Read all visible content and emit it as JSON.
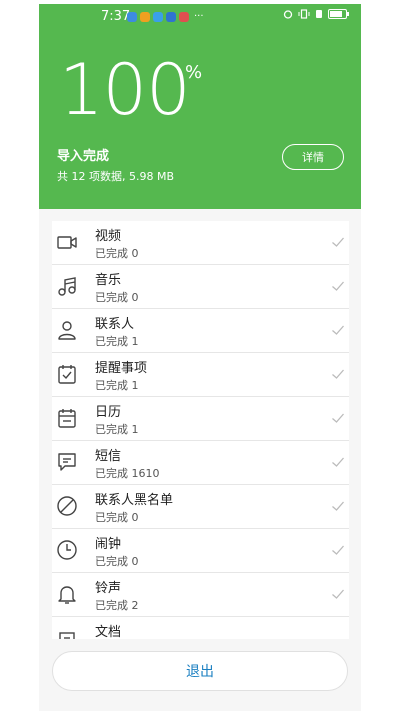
{
  "status_bar": {
    "time": "7:37",
    "more": "···"
  },
  "header": {
    "percent": "100",
    "percent_sign": "%",
    "title": "导入完成",
    "summary": "共 12 项数据, 5.98 MB",
    "details_label": "详情"
  },
  "colors": {
    "header_bg": "#55b84f",
    "exit_text": "#1a7fc1"
  },
  "items": [
    {
      "label": "视频",
      "status": "已完成  0",
      "icon": "video-icon"
    },
    {
      "label": "音乐",
      "status": "已完成  0",
      "icon": "music-icon"
    },
    {
      "label": "联系人",
      "status": "已完成  1",
      "icon": "contact-icon"
    },
    {
      "label": "提醒事项",
      "status": "已完成  1",
      "icon": "reminder-icon"
    },
    {
      "label": "日历",
      "status": "已完成  1",
      "icon": "calendar-icon"
    },
    {
      "label": "短信",
      "status": "已完成  1610",
      "icon": "message-icon"
    },
    {
      "label": "联系人黑名单",
      "status": "已完成  0",
      "icon": "blocked-icon"
    },
    {
      "label": "闹钟",
      "status": "已完成  0",
      "icon": "clock-icon"
    },
    {
      "label": "铃声",
      "status": "已完成  2",
      "icon": "bell-icon"
    },
    {
      "label": "文档",
      "status": "",
      "icon": "document-icon"
    }
  ],
  "footer": {
    "exit_label": "退出"
  }
}
